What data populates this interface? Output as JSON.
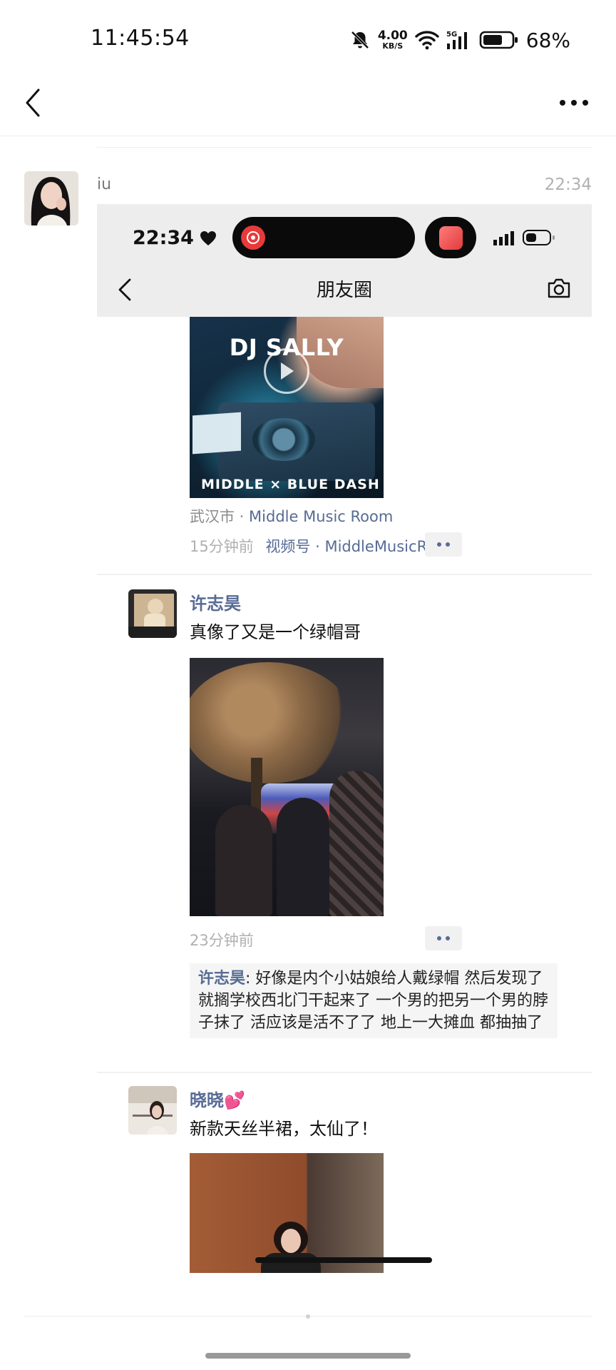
{
  "status_bar": {
    "time": "11:45:54",
    "net_speed_value": "4.00",
    "net_speed_unit": "KB/S",
    "signal_label": "5G",
    "battery_percent": "68%",
    "battery_level": 0.68
  },
  "nav": {
    "back_icon": "chevron-left-icon",
    "more_icon": "more-dots-icon"
  },
  "message": {
    "sender": "iu",
    "time": "22:34"
  },
  "screenshot": {
    "status_time": "22:34",
    "title": "朋友圈",
    "feed": {
      "video": {
        "title": "DJ SALLY",
        "brand": "MIDDLE × BLUE DASH",
        "location_city": "武汉市",
        "location_separator": " · ",
        "location_place": "Middle Music Room",
        "time_ago": "15分钟前",
        "channel": "视频号 · MiddleMusicRoom"
      },
      "post1": {
        "author": "许志昊",
        "text": "真像了又是一个绿帽哥",
        "time_ago": "23分钟前",
        "comment_author": "许志昊",
        "comment_sep": ": ",
        "comment_text": "好像是内个小姑娘给人戴绿帽 然后发现了 就搁学校西北门干起来了 一个男的把另一个男的脖子抹了 活应该是活不了了 地上一大摊血 都抽抽了"
      },
      "post2": {
        "author": "晓晓💕",
        "text": "新款天丝半裙，太仙了！"
      }
    }
  },
  "colors": {
    "link_blue": "#576b95",
    "meta_gray": "#b0b0b0"
  }
}
